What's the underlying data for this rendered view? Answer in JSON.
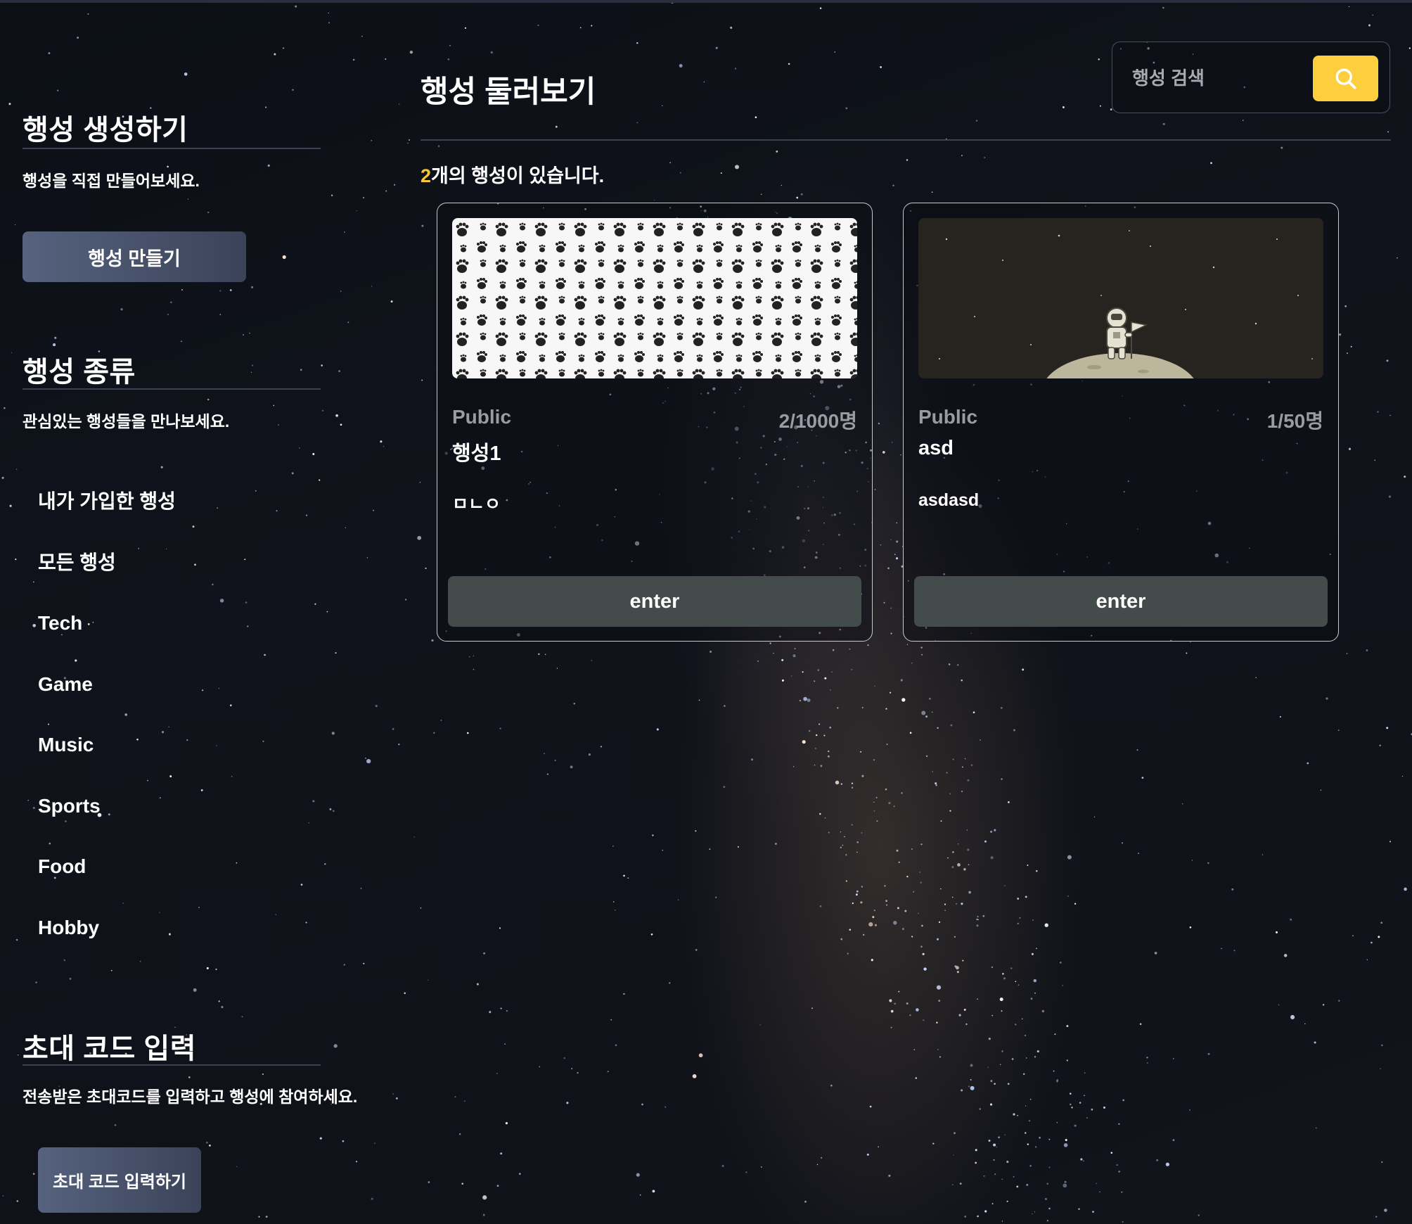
{
  "sidebar": {
    "create": {
      "title": "행성 생성하기",
      "subtitle": "행성을 직접 만들어보세요.",
      "button_label": "행성 만들기"
    },
    "categories": {
      "title": "행성 종류",
      "subtitle": "관심있는 행성들을 만나보세요.",
      "items": [
        "내가 가입한 행성",
        "모든 행성",
        "Tech",
        "Game",
        "Music",
        "Sports",
        "Food",
        "Hobby"
      ]
    },
    "invite": {
      "title": "초대 코드 입력",
      "subtitle": "전송받은 초대코드를 입력하고 행성에 참여하세요.",
      "button_label": "초대 코드 입력하기"
    }
  },
  "main": {
    "title": "행성 둘러보기",
    "search": {
      "placeholder": "행성 검색",
      "value": ""
    },
    "count": {
      "number": "2",
      "suffix": "개의 행성이 있습니다."
    },
    "cards": [
      {
        "image": "paw-print-pattern",
        "visibility": "Public",
        "members": "2/1000명",
        "name": "행성1",
        "description": "ㅁㄴㅇ",
        "button_label": "enter"
      },
      {
        "image": "astronaut-on-moon",
        "visibility": "Public",
        "members": "1/50명",
        "name": "asd",
        "description": "asdasd",
        "button_label": "enter"
      }
    ]
  },
  "colors": {
    "accent": "#fdcf3f",
    "count_highlight": "#f5c53a",
    "enter_button": "#434c4a",
    "muted_text": "#9a9ca3"
  },
  "icons": {
    "search_button": "search-icon"
  }
}
